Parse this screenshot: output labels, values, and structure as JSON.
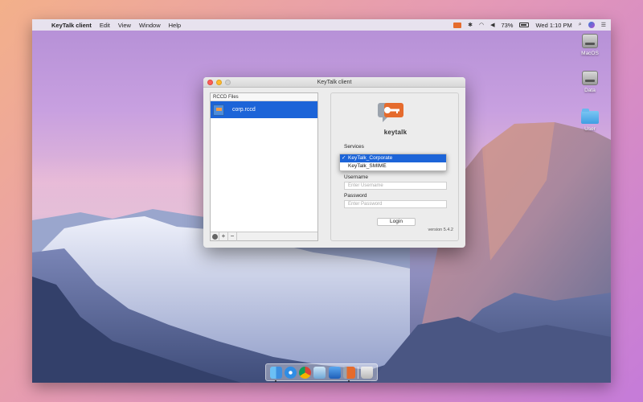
{
  "menubar": {
    "apple": "",
    "app_name": "KeyTalk client",
    "menus": [
      "Edit",
      "View",
      "Window",
      "Help"
    ],
    "battery_percent": "73%",
    "clock": "Wed 1:10 PM"
  },
  "desktop_icons": [
    "MacOS",
    "Data",
    "User"
  ],
  "window": {
    "title": "KeyTalk client",
    "rccd_header": "RCCD Files",
    "files": [
      "corp.rccd"
    ],
    "footer_buttons": [
      "+",
      "−"
    ],
    "logo_text": "keytalk",
    "services_label": "Services",
    "services": [
      "KeyTalk_Corporate",
      "KeyTalk_SMIME"
    ],
    "selected_service": "KeyTalk_Corporate",
    "check_mark": "✓",
    "username_label": "Username",
    "username_placeholder": "Enter Username",
    "password_label": "Password",
    "password_placeholder": "Enter Password",
    "login_button": "Login",
    "version": "version 5.4.2"
  },
  "dock_apps": [
    "finder-icon",
    "safari-icon",
    "chrome-icon",
    "preview-icon",
    "xcode-icon",
    "keytalk-icon",
    "trash-icon"
  ],
  "colors": {
    "accent": "#1c64d8",
    "keytalk_orange": "#e56b2d"
  }
}
